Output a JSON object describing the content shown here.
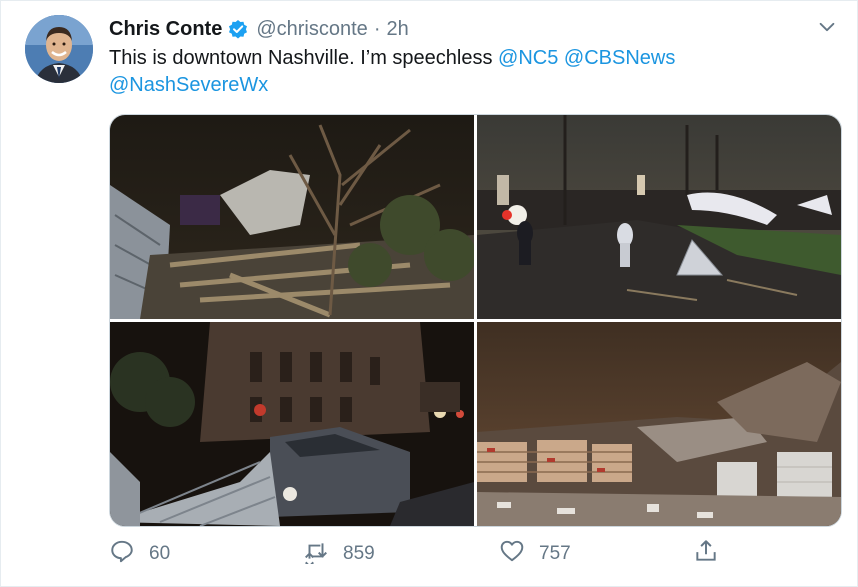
{
  "tweet": {
    "author_name": "Chris Conte",
    "author_handle": "@chrisconte",
    "separator": "·",
    "time": "2h",
    "text_plain": "This is downtown Nashville. I’m speechless ",
    "mentions": [
      "@NC5",
      "@CBSNews",
      "@NashSevereWx"
    ],
    "verified_color": "#1da1f2"
  },
  "photos": [
    {
      "alt": "storm-debris-wreckage"
    },
    {
      "alt": "street-with-debris-at-night"
    },
    {
      "alt": "damaged-buildings-and-car"
    },
    {
      "alt": "collapsed-store-interior"
    }
  ],
  "actions": {
    "reply_count": "60",
    "retweet_count": "859",
    "like_count": "757"
  },
  "icons": {
    "verified": "verified-badge-icon",
    "caret": "chevron-down-icon",
    "reply": "reply-icon",
    "retweet": "retweet-icon",
    "like": "heart-icon",
    "share": "share-icon"
  },
  "colors": {
    "link": "#1b95e0",
    "muted": "#657786",
    "text": "#14171a"
  }
}
